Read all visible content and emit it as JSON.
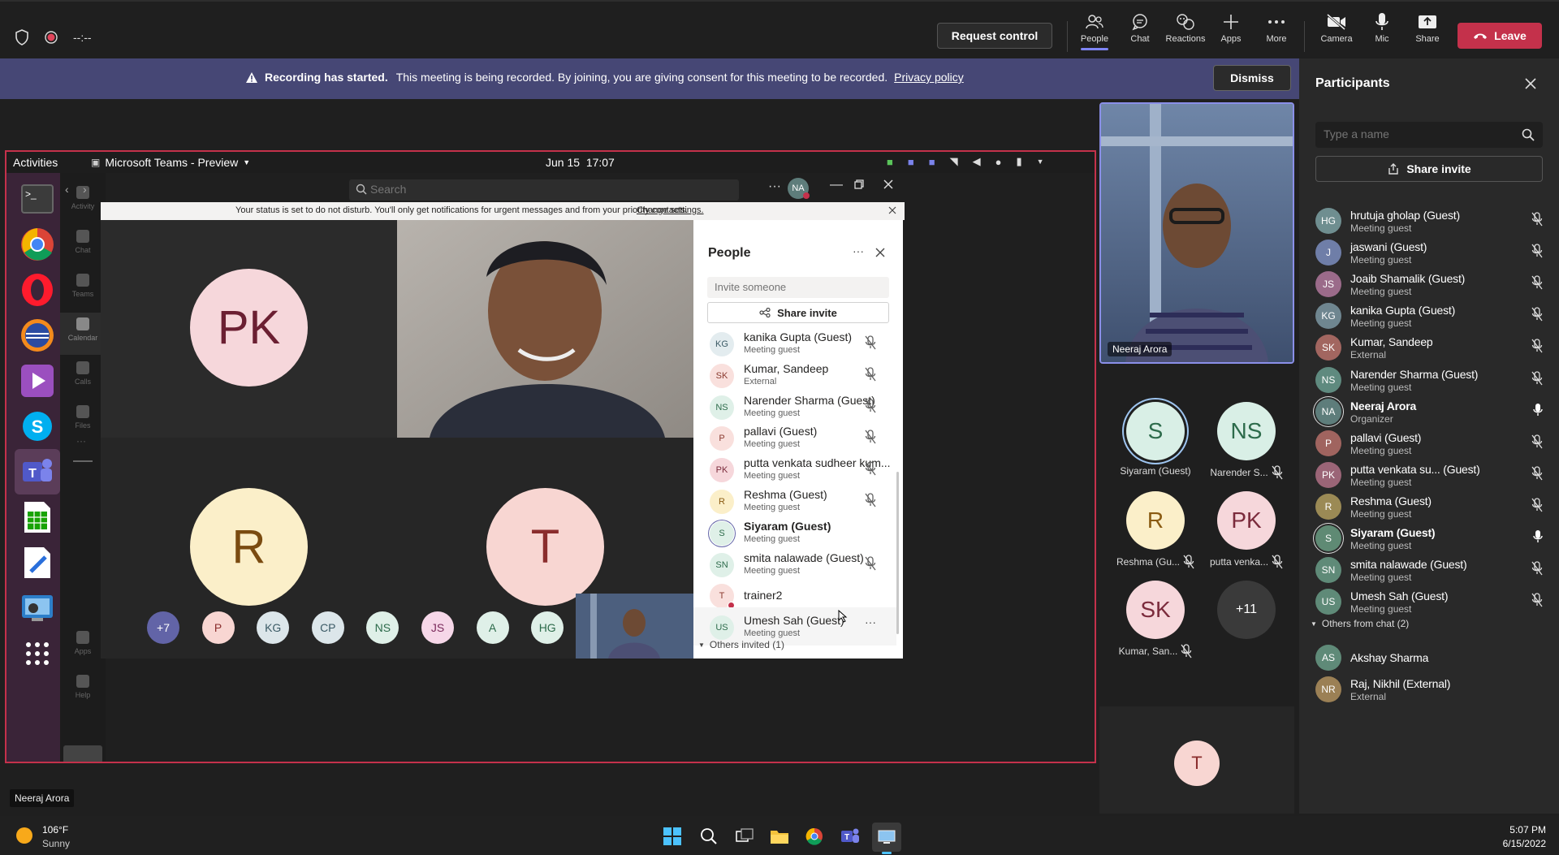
{
  "topbar": {
    "timer": "--:--",
    "request_control": "Request control",
    "people": "People",
    "chat": "Chat",
    "reactions": "Reactions",
    "apps": "Apps",
    "more": "More",
    "camera": "Camera",
    "mic": "Mic",
    "share": "Share",
    "leave": "Leave"
  },
  "banner": {
    "bold": "Recording has started.",
    "text": "This meeting is being recorded. By joining, you are giving consent for this meeting to be recorded.",
    "link": "Privacy policy",
    "dismiss": "Dismiss"
  },
  "participants_panel": {
    "title": "Participants",
    "search_placeholder": "Type a name",
    "share_invite": "Share invite",
    "people": [
      {
        "initials": "HG",
        "name": "hrutuja gholap (Guest)",
        "role": "Meeting guest",
        "color": "#6f8e90",
        "muted": true
      },
      {
        "initials": "J",
        "name": "jaswani (Guest)",
        "role": "Meeting guest",
        "color": "#6f7ea8",
        "muted": true
      },
      {
        "initials": "JS",
        "name": "Joaib Shamalik (Guest)",
        "role": "Meeting guest",
        "color": "#9b6b8a",
        "muted": true
      },
      {
        "initials": "KG",
        "name": "kanika Gupta (Guest)",
        "role": "Meeting guest",
        "color": "#6f8690",
        "muted": true
      },
      {
        "initials": "SK",
        "name": "Kumar, Sandeep",
        "role": "External",
        "color": "#a26660",
        "muted": true
      },
      {
        "initials": "NS",
        "name": "Narender Sharma (Guest)",
        "role": "Meeting guest",
        "color": "#5f8a7f",
        "muted": true
      },
      {
        "initials": "NA",
        "name": "Neeraj Arora",
        "role": "Organizer",
        "color": "#5e7d7b",
        "muted": false,
        "bold": true,
        "ring": true
      },
      {
        "initials": "P",
        "name": "pallavi (Guest)",
        "role": "Meeting guest",
        "color": "#a0645f",
        "muted": true
      },
      {
        "initials": "PK",
        "name": "putta venkata su... (Guest)",
        "role": "Meeting guest",
        "color": "#9b6577",
        "muted": true
      },
      {
        "initials": "R",
        "name": "Reshma (Guest)",
        "role": "Meeting guest",
        "color": "#9b8a55",
        "muted": true
      },
      {
        "initials": "S",
        "name": "Siyaram (Guest)",
        "role": "Meeting guest",
        "color": "#5f8a74",
        "muted": false,
        "bold": true,
        "ring": true
      },
      {
        "initials": "SN",
        "name": "smita nalawade (Guest)",
        "role": "Meeting guest",
        "color": "#5f8a78",
        "muted": true
      },
      {
        "initials": "US",
        "name": "Umesh Sah (Guest)",
        "role": "Meeting guest",
        "color": "#5f8a78",
        "muted": true
      }
    ],
    "others_header": "Others from chat (2)",
    "others": [
      {
        "initials": "AS",
        "name": "Akshay Sharma",
        "role": "",
        "color": "#5f8a78"
      },
      {
        "initials": "NR",
        "name": "Raj, Nikhil (External)",
        "role": "External",
        "color": "#9b8055"
      }
    ]
  },
  "stage": {
    "self_video_name": "Neeraj Arora",
    "gallery": [
      {
        "initials": "S",
        "label": "Siyaram (Guest)",
        "bg": "#d9efe6",
        "fg": "#2d6b4b",
        "ring": true,
        "muted": false
      },
      {
        "initials": "NS",
        "label": "Narender S...",
        "bg": "#d9efe6",
        "fg": "#2d6b4b",
        "muted": true
      },
      {
        "initials": "R",
        "label": "Reshma (Gu...",
        "bg": "#fbefc9",
        "fg": "#8a5b12",
        "muted": true
      },
      {
        "initials": "PK",
        "label": "putta venka...",
        "bg": "#f6d7db",
        "fg": "#7b2b3c",
        "muted": true
      },
      {
        "initials": "SK",
        "label": "Kumar, San...",
        "bg": "#f6d7db",
        "fg": "#7b2b3c",
        "muted": true
      },
      {
        "initials": "+11",
        "label": "",
        "bg": "#3a3a3a",
        "fg": "#ffffff",
        "muted": false
      }
    ],
    "bottom_tile": "T",
    "hover_tooltip": "Neeraj Arora"
  },
  "remote": {
    "activities": "Activities",
    "app_name": "Microsoft Teams - Preview",
    "clock": "Jun 15  17:07",
    "search_placeholder": "Search",
    "avatar": "NA",
    "status_msg": "Your status is set to do not disturb. You'll only get notifications for urgent messages and from your priority contacts.",
    "status_link": "Change settings.",
    "rail": [
      "Activity",
      "Chat",
      "Teams",
      "Calendar",
      "Calls",
      "Files",
      "Apps",
      "Help"
    ],
    "tiles": [
      "PK",
      "R",
      "T"
    ],
    "strip": [
      "+7",
      "P",
      "KG",
      "CP",
      "NS",
      "JS",
      "A",
      "HG"
    ],
    "people_title": "People",
    "invite_placeholder": "Invite someone",
    "share_invite": "Share invite",
    "people": [
      {
        "initials": "KG",
        "name": "kanika Gupta (Guest)",
        "role": "Meeting guest",
        "bg": "#e3ecef",
        "fg": "#3c5b66",
        "muted": true
      },
      {
        "initials": "SK",
        "name": "Kumar, Sandeep",
        "role": "External",
        "bg": "#f9e0dd",
        "fg": "#8a3a2f",
        "muted": true
      },
      {
        "initials": "NS",
        "name": "Narender Sharma (Guest)",
        "role": "Meeting guest",
        "bg": "#dff0e8",
        "fg": "#2d6b4b",
        "muted": true
      },
      {
        "initials": "P",
        "name": "pallavi (Guest)",
        "role": "Meeting guest",
        "bg": "#f9e0dd",
        "fg": "#8a3a2f",
        "muted": true
      },
      {
        "initials": "PK",
        "name": "putta venkata sudheer kum...",
        "role": "Meeting guest",
        "bg": "#f6d7db",
        "fg": "#7b2b3c",
        "muted": true
      },
      {
        "initials": "R",
        "name": "Reshma (Guest)",
        "role": "Meeting guest",
        "bg": "#fbefc9",
        "fg": "#8a5b12",
        "muted": true
      },
      {
        "initials": "S",
        "name": "Siyaram (Guest)",
        "role": "Meeting guest",
        "bg": "#dff0e8",
        "fg": "#2d6b4b",
        "muted": false,
        "bold": true
      },
      {
        "initials": "SN",
        "name": "smita nalawade (Guest)",
        "role": "Meeting guest",
        "bg": "#dff0e8",
        "fg": "#2d6b4b",
        "muted": true
      },
      {
        "initials": "T",
        "name": "trainer2",
        "role": "",
        "bg": "#f9e0dd",
        "fg": "#8a3a2f",
        "muted": false
      },
      {
        "initials": "US",
        "name": "Umesh Sah (Guest)",
        "role": "Meeting guest",
        "bg": "#dff0e8",
        "fg": "#2d6b4b",
        "muted": false,
        "more": true
      }
    ],
    "others_invited": "Others invited (1)"
  },
  "taskbar": {
    "temp": "106°F",
    "weather": "Sunny",
    "time": "5:07 PM",
    "date": "6/15/2022"
  }
}
